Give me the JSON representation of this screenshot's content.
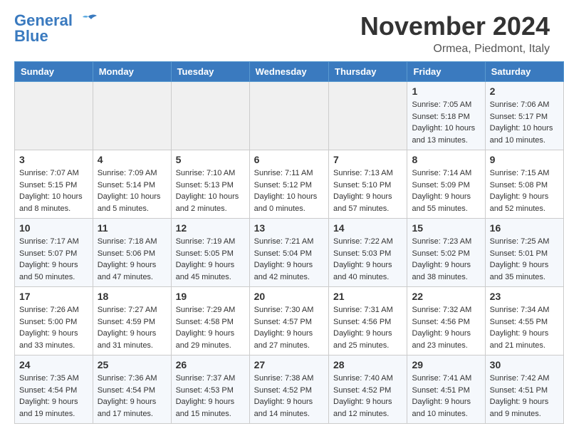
{
  "header": {
    "logo_line1": "General",
    "logo_line2": "Blue",
    "month_title": "November 2024",
    "location": "Ormea, Piedmont, Italy"
  },
  "weekdays": [
    "Sunday",
    "Monday",
    "Tuesday",
    "Wednesday",
    "Thursday",
    "Friday",
    "Saturday"
  ],
  "weeks": [
    [
      {
        "day": "",
        "info": ""
      },
      {
        "day": "",
        "info": ""
      },
      {
        "day": "",
        "info": ""
      },
      {
        "day": "",
        "info": ""
      },
      {
        "day": "",
        "info": ""
      },
      {
        "day": "1",
        "info": "Sunrise: 7:05 AM\nSunset: 5:18 PM\nDaylight: 10 hours and 13 minutes."
      },
      {
        "day": "2",
        "info": "Sunrise: 7:06 AM\nSunset: 5:17 PM\nDaylight: 10 hours and 10 minutes."
      }
    ],
    [
      {
        "day": "3",
        "info": "Sunrise: 7:07 AM\nSunset: 5:15 PM\nDaylight: 10 hours and 8 minutes."
      },
      {
        "day": "4",
        "info": "Sunrise: 7:09 AM\nSunset: 5:14 PM\nDaylight: 10 hours and 5 minutes."
      },
      {
        "day": "5",
        "info": "Sunrise: 7:10 AM\nSunset: 5:13 PM\nDaylight: 10 hours and 2 minutes."
      },
      {
        "day": "6",
        "info": "Sunrise: 7:11 AM\nSunset: 5:12 PM\nDaylight: 10 hours and 0 minutes."
      },
      {
        "day": "7",
        "info": "Sunrise: 7:13 AM\nSunset: 5:10 PM\nDaylight: 9 hours and 57 minutes."
      },
      {
        "day": "8",
        "info": "Sunrise: 7:14 AM\nSunset: 5:09 PM\nDaylight: 9 hours and 55 minutes."
      },
      {
        "day": "9",
        "info": "Sunrise: 7:15 AM\nSunset: 5:08 PM\nDaylight: 9 hours and 52 minutes."
      }
    ],
    [
      {
        "day": "10",
        "info": "Sunrise: 7:17 AM\nSunset: 5:07 PM\nDaylight: 9 hours and 50 minutes."
      },
      {
        "day": "11",
        "info": "Sunrise: 7:18 AM\nSunset: 5:06 PM\nDaylight: 9 hours and 47 minutes."
      },
      {
        "day": "12",
        "info": "Sunrise: 7:19 AM\nSunset: 5:05 PM\nDaylight: 9 hours and 45 minutes."
      },
      {
        "day": "13",
        "info": "Sunrise: 7:21 AM\nSunset: 5:04 PM\nDaylight: 9 hours and 42 minutes."
      },
      {
        "day": "14",
        "info": "Sunrise: 7:22 AM\nSunset: 5:03 PM\nDaylight: 9 hours and 40 minutes."
      },
      {
        "day": "15",
        "info": "Sunrise: 7:23 AM\nSunset: 5:02 PM\nDaylight: 9 hours and 38 minutes."
      },
      {
        "day": "16",
        "info": "Sunrise: 7:25 AM\nSunset: 5:01 PM\nDaylight: 9 hours and 35 minutes."
      }
    ],
    [
      {
        "day": "17",
        "info": "Sunrise: 7:26 AM\nSunset: 5:00 PM\nDaylight: 9 hours and 33 minutes."
      },
      {
        "day": "18",
        "info": "Sunrise: 7:27 AM\nSunset: 4:59 PM\nDaylight: 9 hours and 31 minutes."
      },
      {
        "day": "19",
        "info": "Sunrise: 7:29 AM\nSunset: 4:58 PM\nDaylight: 9 hours and 29 minutes."
      },
      {
        "day": "20",
        "info": "Sunrise: 7:30 AM\nSunset: 4:57 PM\nDaylight: 9 hours and 27 minutes."
      },
      {
        "day": "21",
        "info": "Sunrise: 7:31 AM\nSunset: 4:56 PM\nDaylight: 9 hours and 25 minutes."
      },
      {
        "day": "22",
        "info": "Sunrise: 7:32 AM\nSunset: 4:56 PM\nDaylight: 9 hours and 23 minutes."
      },
      {
        "day": "23",
        "info": "Sunrise: 7:34 AM\nSunset: 4:55 PM\nDaylight: 9 hours and 21 minutes."
      }
    ],
    [
      {
        "day": "24",
        "info": "Sunrise: 7:35 AM\nSunset: 4:54 PM\nDaylight: 9 hours and 19 minutes."
      },
      {
        "day": "25",
        "info": "Sunrise: 7:36 AM\nSunset: 4:54 PM\nDaylight: 9 hours and 17 minutes."
      },
      {
        "day": "26",
        "info": "Sunrise: 7:37 AM\nSunset: 4:53 PM\nDaylight: 9 hours and 15 minutes."
      },
      {
        "day": "27",
        "info": "Sunrise: 7:38 AM\nSunset: 4:52 PM\nDaylight: 9 hours and 14 minutes."
      },
      {
        "day": "28",
        "info": "Sunrise: 7:40 AM\nSunset: 4:52 PM\nDaylight: 9 hours and 12 minutes."
      },
      {
        "day": "29",
        "info": "Sunrise: 7:41 AM\nSunset: 4:51 PM\nDaylight: 9 hours and 10 minutes."
      },
      {
        "day": "30",
        "info": "Sunrise: 7:42 AM\nSunset: 4:51 PM\nDaylight: 9 hours and 9 minutes."
      }
    ]
  ]
}
